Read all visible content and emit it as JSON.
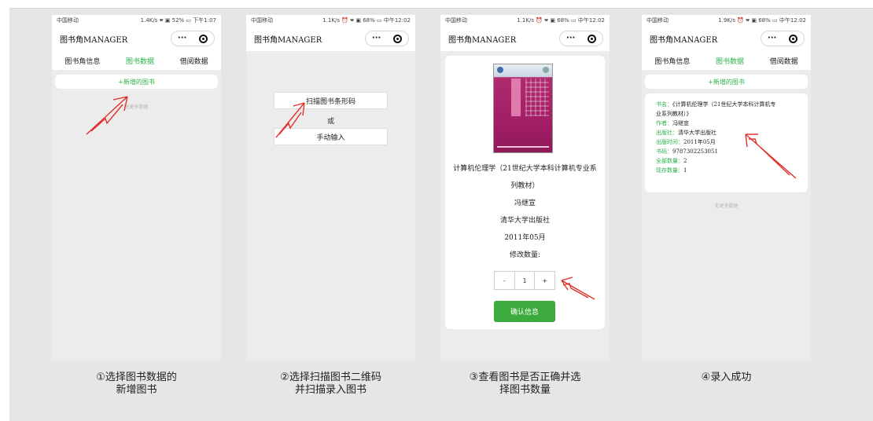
{
  "shared": {
    "app_title": "图书角MANAGER",
    "capsule_more": "···",
    "tabs": [
      "图书角信息",
      "图书数据",
      "借阅数据"
    ],
    "add_new": "+新增的图书",
    "no_more": "无更多数据"
  },
  "screens": [
    {
      "status_left": "中国移动",
      "status_right": "1.4K/s 🕿 ▣ 52% ▭ 下午1:07",
      "caption_lines": [
        "①选择图书数据的",
        "新增图书"
      ]
    },
    {
      "status_left": "中国移动",
      "status_right": "1.1K/s ⏰ 🕿 ▣ 68% ▭ 中午12:02",
      "scan_button": "扫描图书条形码",
      "or_text": "或",
      "manual_button": "手动输入",
      "caption_lines": [
        "②选择扫描图书二维码",
        "并扫描录入图书"
      ]
    },
    {
      "status_left": "中国移动",
      "status_right": "1.1K/s ⏰ 🕿 ▣ 68% ▭ 中午12:02",
      "book_title_line1": "计算机伦理学（21世纪大学本科计算机专业系",
      "book_title_line2": "列教材）",
      "author": "冯继宣",
      "publisher": "清华大学出版社",
      "pub_date": "2011年05月",
      "quantity_label": "修改数量:",
      "quantity_minus": "-",
      "quantity_value": "1",
      "quantity_plus": "+",
      "confirm_button": "确认信息",
      "caption_lines": [
        "③查看图书是否正确并选",
        "择图书数量"
      ]
    },
    {
      "status_left": "中国移动",
      "status_right": "1.9K/s ⏰ 🕿 ▣ 68% ▭ 中午12:02",
      "info": {
        "title_label": "书名：",
        "title_value": "《计算机伦理学（21世纪大学本科计算机专",
        "title_value2": "业系列教材）》",
        "author_label": "作者：",
        "author_value": "冯继宣",
        "publisher_label": "出版社：",
        "publisher_value": "清华大学出版社",
        "date_label": "出版时间：",
        "date_value": "2011年05月",
        "isbn_label": "书码：",
        "isbn_value": "9787302253051",
        "total_label": "全部数量：",
        "total_value": "2",
        "available_label": "现存数量：",
        "available_value": "1"
      },
      "caption_lines": [
        "④录入成功"
      ]
    }
  ],
  "colors": {
    "accent_green": "#2bb24c",
    "confirm_green": "#3caa3c",
    "arrow_red": "#e0322b",
    "background": "#e6e6e6"
  }
}
